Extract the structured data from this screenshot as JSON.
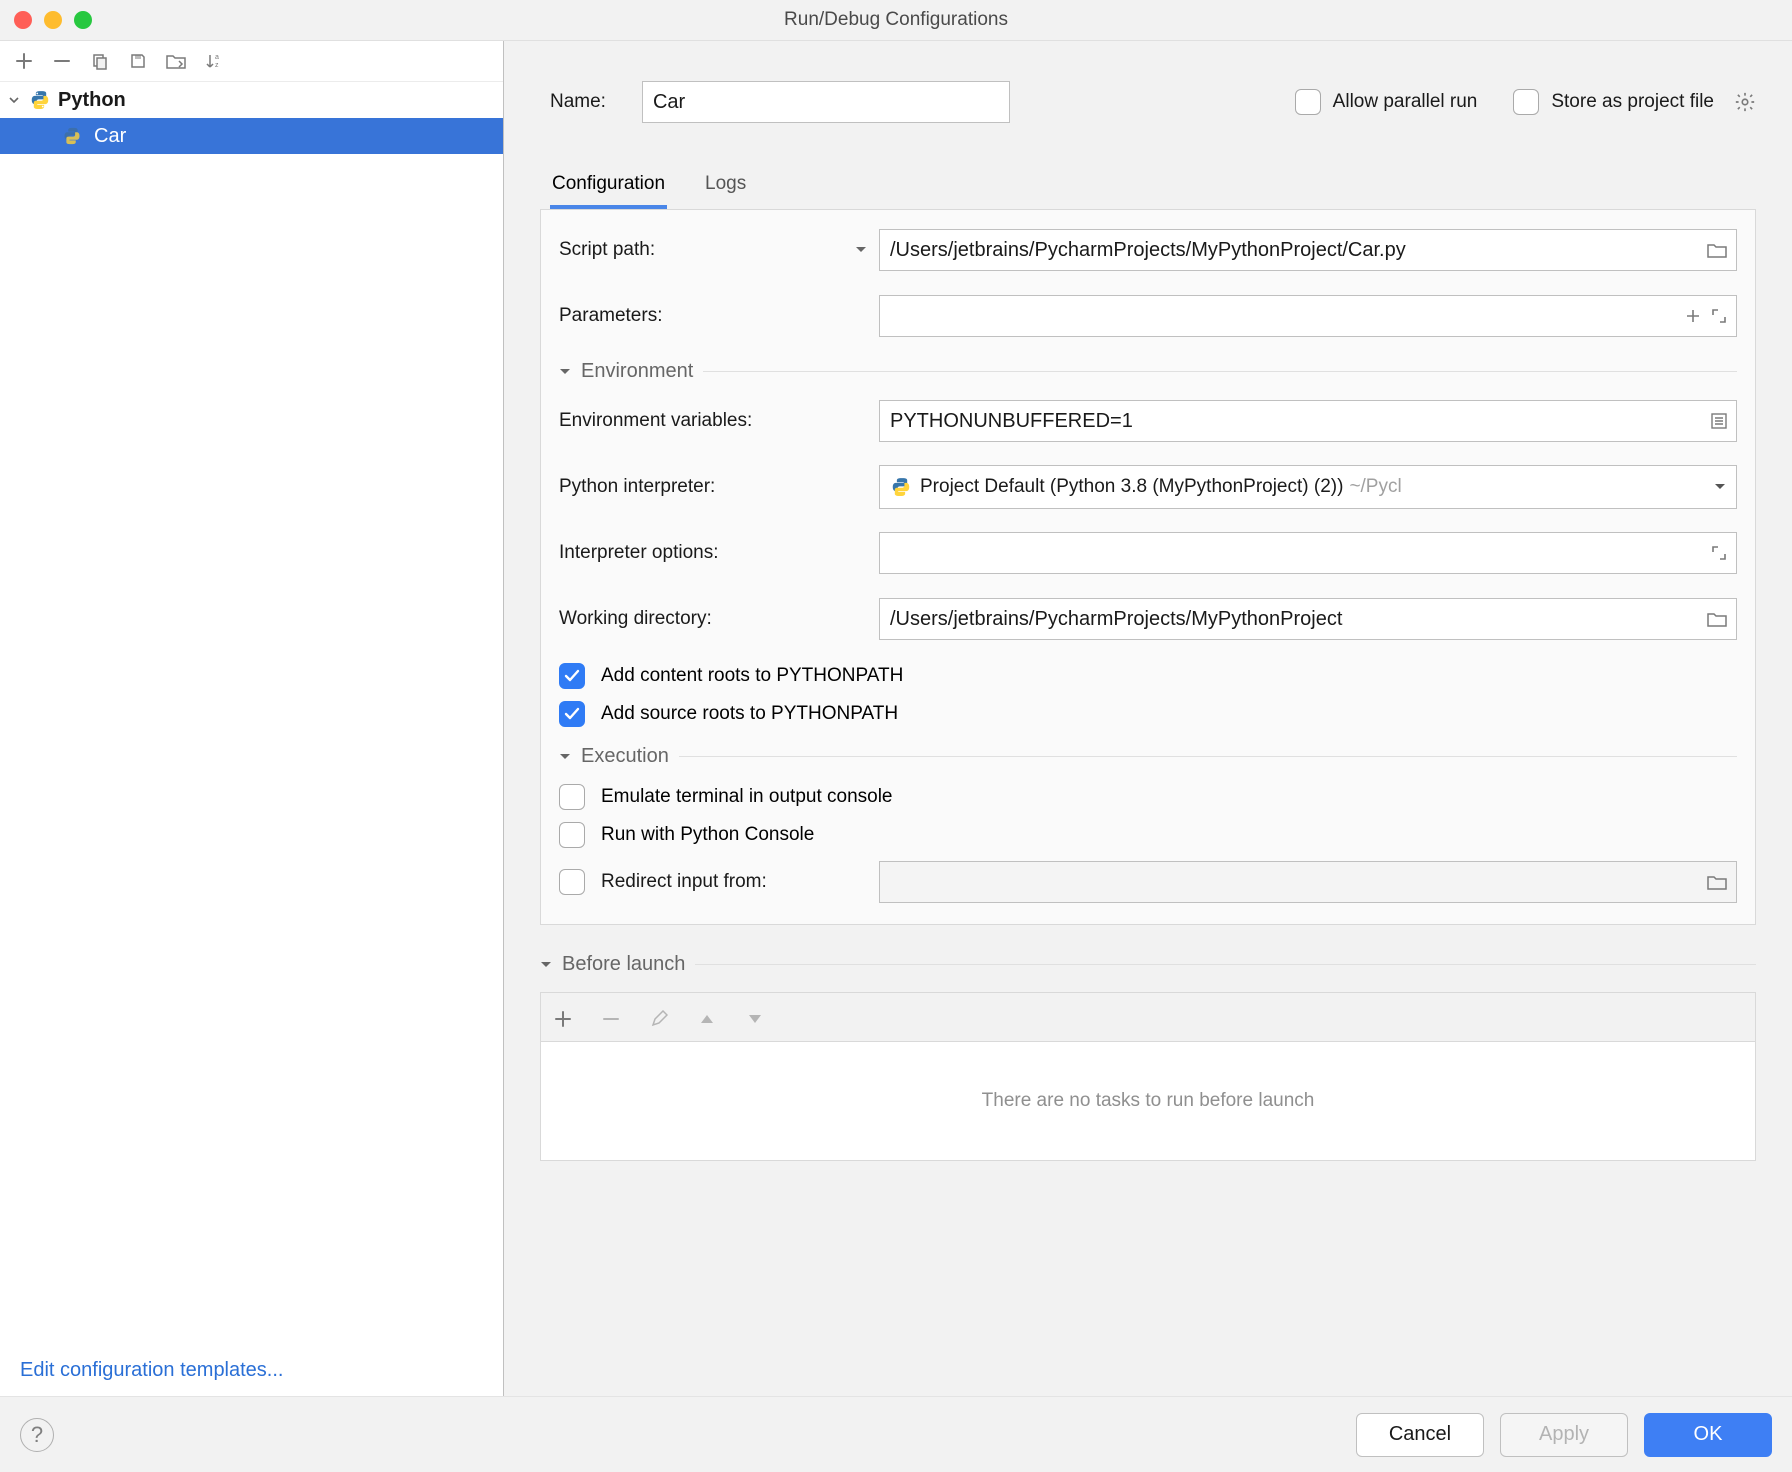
{
  "title": "Run/Debug Configurations",
  "sidebar": {
    "group": "Python",
    "group_icon": "python-icon",
    "items": [
      {
        "label": "Car",
        "selected": true
      }
    ],
    "footer_link": "Edit configuration templates..."
  },
  "name": {
    "label": "Name:",
    "value": "Car"
  },
  "options": {
    "allow_parallel": {
      "label": "Allow parallel run",
      "checked": false
    },
    "store_as_project_file": {
      "label": "Store as project file",
      "checked": false
    }
  },
  "tabs": [
    {
      "label": "Configuration",
      "active": true
    },
    {
      "label": "Logs",
      "active": false
    }
  ],
  "form": {
    "script_path": {
      "label": "Script path:",
      "value": "/Users/jetbrains/PycharmProjects/MyPythonProject/Car.py"
    },
    "parameters": {
      "label": "Parameters:",
      "value": ""
    },
    "environment_header": "Environment",
    "env_vars": {
      "label": "Environment variables:",
      "value": "PYTHONUNBUFFERED=1"
    },
    "python_interpreter": {
      "label": "Python interpreter:",
      "value": "Project Default (Python 3.8 (MyPythonProject) (2))",
      "suffix": "~/Pycl"
    },
    "interpreter_options": {
      "label": "Interpreter options:",
      "value": ""
    },
    "working_directory": {
      "label": "Working directory:",
      "value": "/Users/jetbrains/PycharmProjects/MyPythonProject"
    },
    "add_content_roots": {
      "label": "Add content roots to PYTHONPATH",
      "checked": true
    },
    "add_source_roots": {
      "label": "Add source roots to PYTHONPATH",
      "checked": true
    },
    "execution_header": "Execution",
    "emulate_terminal": {
      "label": "Emulate terminal in output console",
      "checked": false
    },
    "run_with_console": {
      "label": "Run with Python Console",
      "checked": false
    },
    "redirect_input": {
      "label": "Redirect input from:",
      "checked": false,
      "value": ""
    }
  },
  "before_launch": {
    "header": "Before launch",
    "empty_text": "There are no tasks to run before launch"
  },
  "footer": {
    "cancel": "Cancel",
    "apply": "Apply",
    "ok": "OK"
  }
}
